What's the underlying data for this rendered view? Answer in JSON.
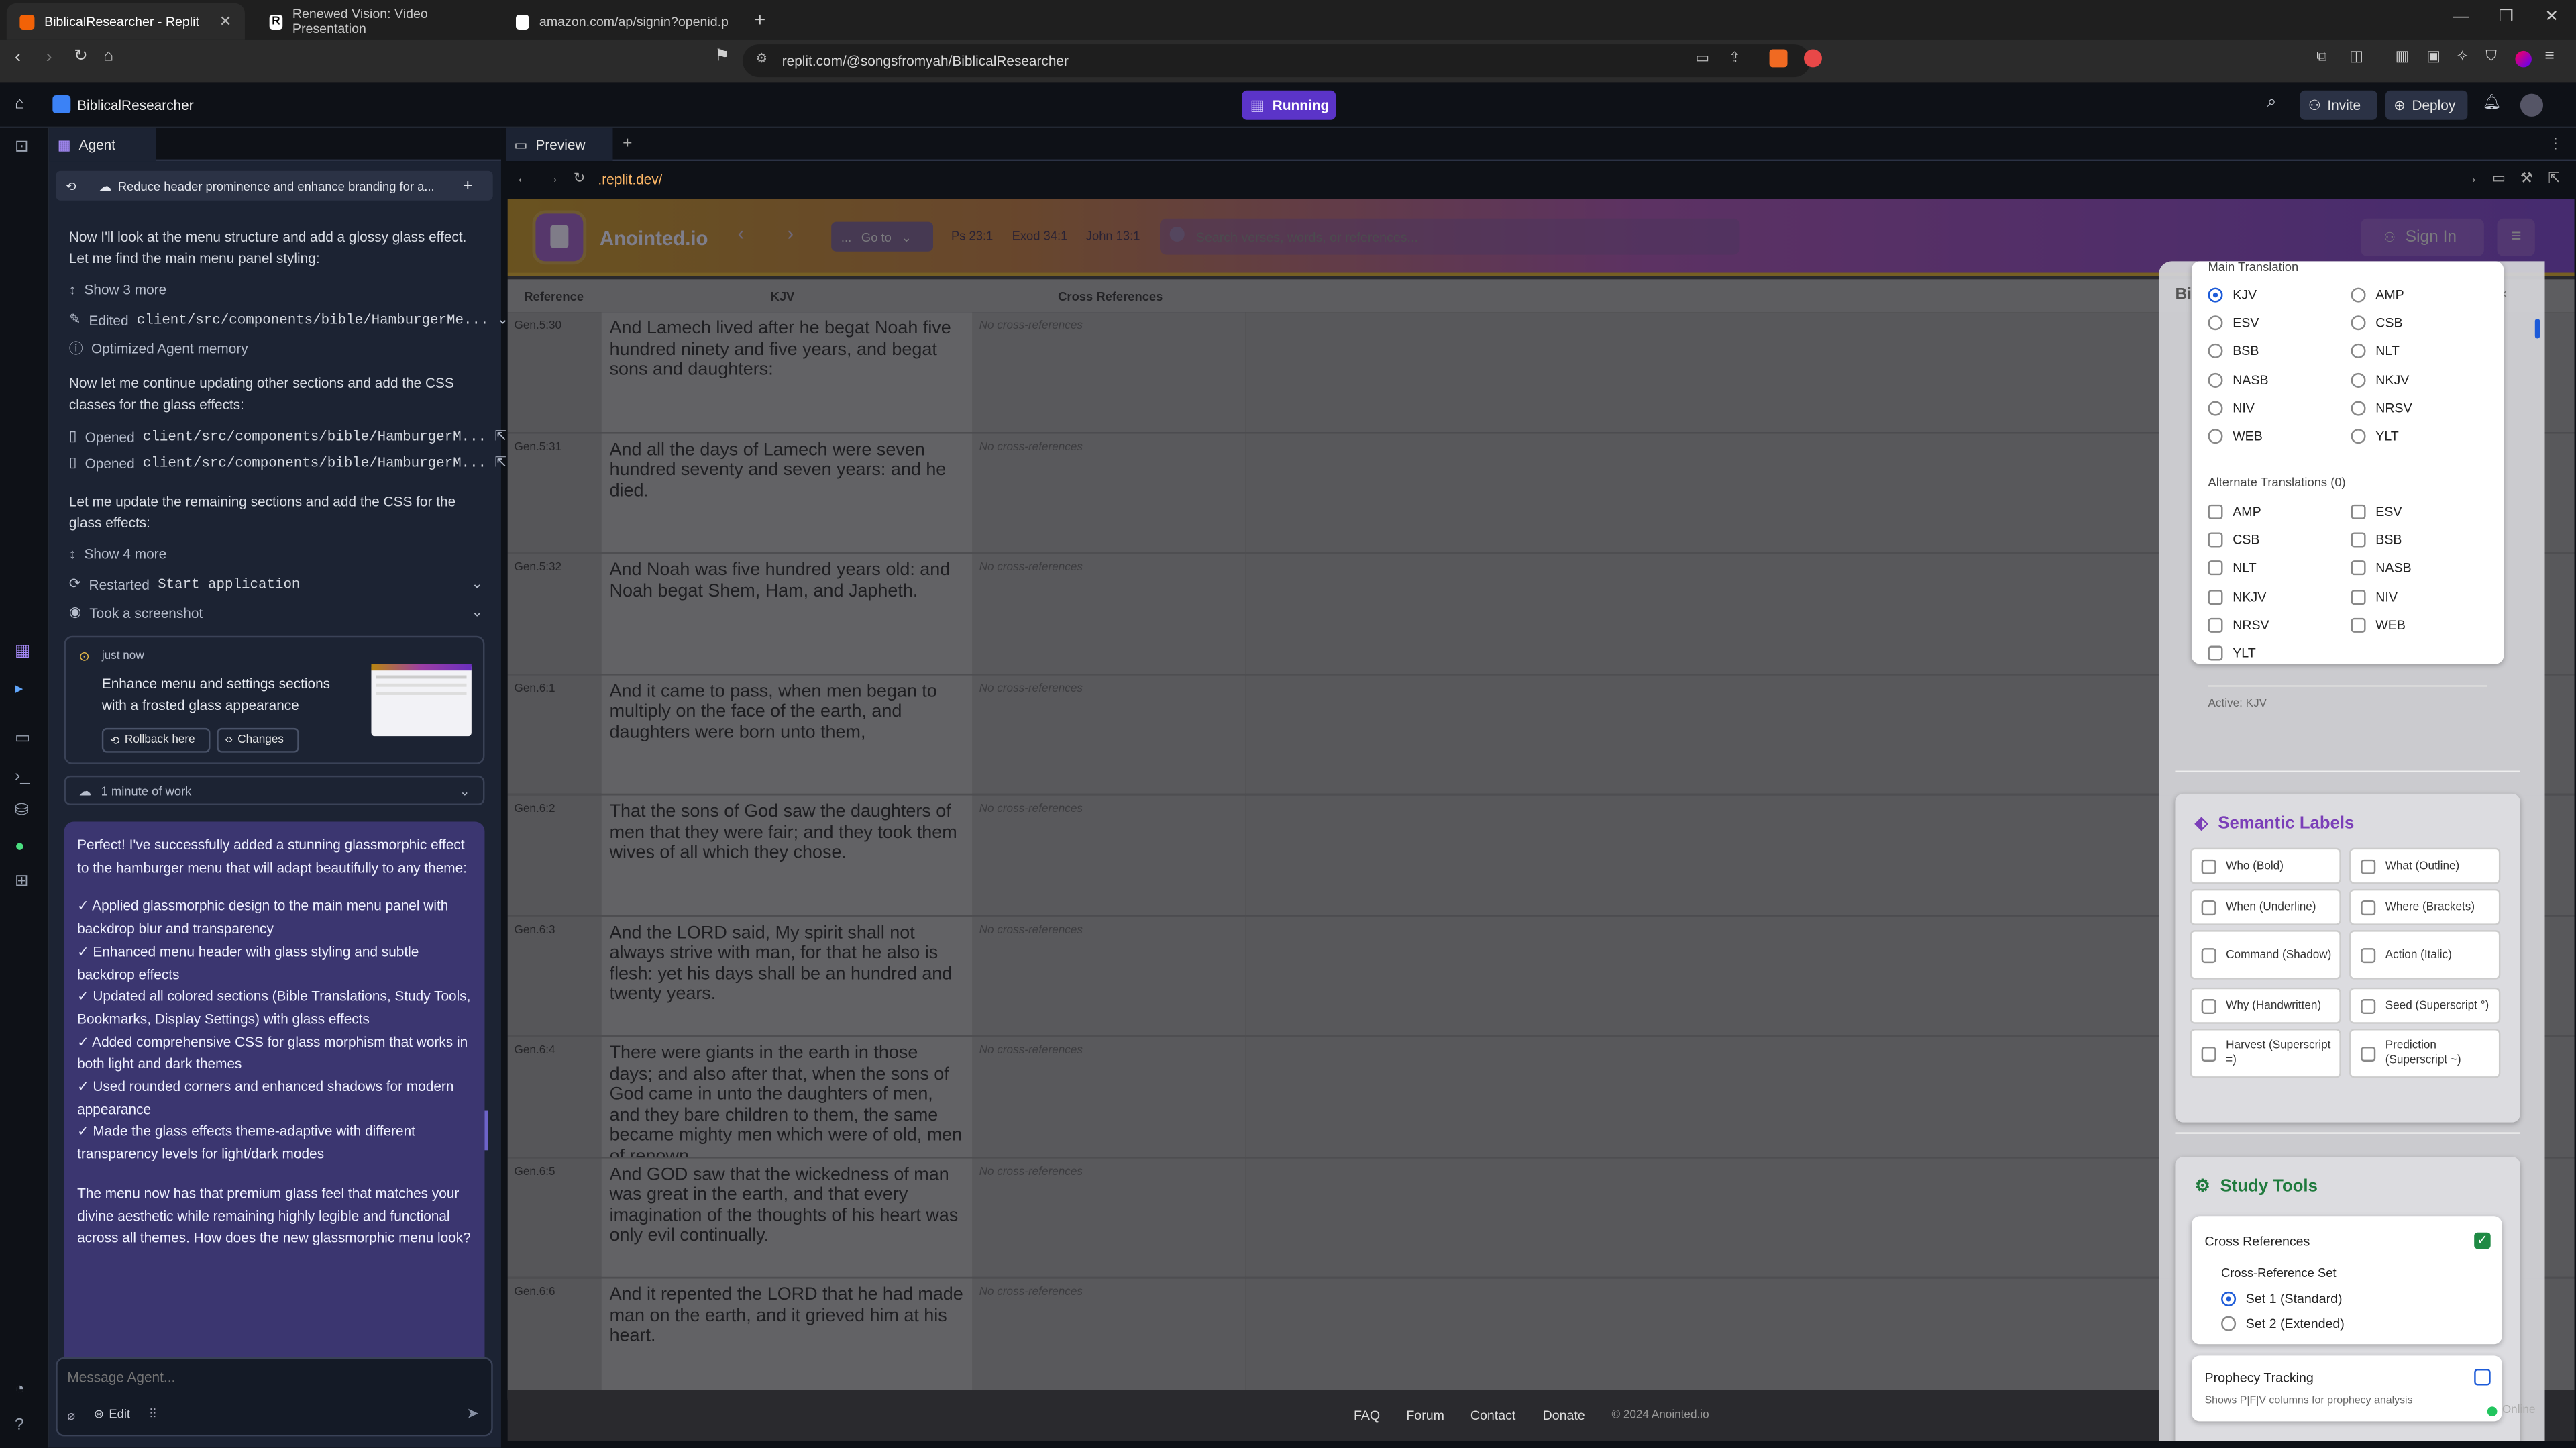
{
  "browser": {
    "tabs": [
      {
        "title": "BiblicalResearcher - Replit",
        "active": true
      },
      {
        "title": "Renewed Vision: Video Presentation",
        "active": false
      },
      {
        "title": "amazon.com/ap/signin?openid.pape",
        "active": false
      }
    ],
    "url": "replit.com/@songsfromyah/BiblicalResearcher"
  },
  "replit": {
    "repl_name": "BiblicalResearcher",
    "run_status": "Running",
    "invite_label": "Invite",
    "deploy_label": "Deploy"
  },
  "agent": {
    "tab_label": "Agent",
    "thread_title": "Reduce header prominence and enhance branding for a...",
    "msg1": "Now I'll look at the menu structure and add a glossy glass effect. Let me find the main menu panel styling:",
    "show3": "Show 3 more",
    "edited_label": "Edited",
    "edited_file": "client/src/components/bible/HamburgerMe...",
    "optimized": "Optimized Agent memory",
    "msg2": "Now let me continue updating other sections and add the CSS classes for the glass effects:",
    "opened_label": "Opened",
    "opened_file1": "client/src/components/bible/HamburgerM...",
    "opened_file2": "client/src/components/bible/HamburgerM...",
    "msg3": "Let me update the remaining sections and add the CSS for the glass effects:",
    "show4": "Show 4 more",
    "restarted_label": "Restarted",
    "restarted_target": "Start application",
    "screenshot": "Took a screenshot",
    "checkpoint_time": "just now",
    "checkpoint_text": "Enhance menu and settings sections with a frosted glass appearance",
    "rollback_label": "Rollback here",
    "changes_label": "Changes",
    "work_label": "1 minute of work",
    "final_intro": "Perfect! I've successfully added a stunning glassmorphic effect to the hamburger menu that will adapt beautifully to any theme:",
    "final_points": [
      "✓ Applied glassmorphic design to the main menu panel with backdrop blur and transparency",
      "✓ Enhanced menu header with glass styling and subtle backdrop effects",
      "✓ Updated all colored sections (Bible Translations, Study Tools, Bookmarks, Display Settings) with glass effects",
      "✓ Added comprehensive CSS for glass morphism that works in both light and dark themes",
      "✓ Used rounded corners and enhanced shadows for modern appearance",
      "✓ Made the glass effects theme-adaptive with different transparency levels for light/dark modes"
    ],
    "final_outro": "The menu now has that premium glass feel that matches your divine aesthetic while remaining highly legible and functional across all themes. How does the new glassmorphic menu look?",
    "input_placeholder": "Message Agent...",
    "edit_label": "Edit"
  },
  "preview": {
    "tab_label": "Preview",
    "address": ".replit.dev/",
    "site": {
      "brand": "Anointed.io",
      "goto_prefix": "...",
      "goto_label": "Go to",
      "quick_refs": [
        "Ps 23:1",
        "Exod 34:1",
        "John 13:1"
      ],
      "search_placeholder": "Search verses, words, or references...",
      "sign_in": "Sign In",
      "columns": [
        "Reference",
        "KJV",
        "Cross References"
      ],
      "verses": [
        {
          "ref": "Gen.5:30",
          "text": "And Lamech lived after he begat Noah five hundred ninety and five years, and begat sons and daughters:",
          "cross": "No cross-references"
        },
        {
          "ref": "Gen.5:31",
          "text": "And all the days of Lamech were seven hundred seventy and seven years: and he died.",
          "cross": "No cross-references"
        },
        {
          "ref": "Gen.5:32",
          "text": "And Noah was five hundred years old: and Noah begat Shem, Ham, and Japheth.",
          "cross": "No cross-references"
        },
        {
          "ref": "Gen.6:1",
          "text": "And it came to pass, when men began to multiply on the face of the earth, and daughters were born unto them,",
          "cross": "No cross-references"
        },
        {
          "ref": "Gen.6:2",
          "text": "That the sons of God saw the daughters of men that they were fair; and they took them wives of all which they chose.",
          "cross": "No cross-references"
        },
        {
          "ref": "Gen.6:3",
          "text": "And the LORD said, My spirit shall not always strive with man, for that he also is flesh: yet his days shall be an hundred and twenty years.",
          "cross": "No cross-references"
        },
        {
          "ref": "Gen.6:4",
          "text": "There were giants in the earth in those days; and also after that, when the sons of God came in unto the daughters of men, and they bare children to them, the same became mighty men which were of old, men of renown.",
          "cross": "No cross-references"
        },
        {
          "ref": "Gen.6:5",
          "text": "And GOD saw that the wickedness of man was great in the earth, and that every imagination of the thoughts of his heart was only evil continually.",
          "cross": "No cross-references"
        },
        {
          "ref": "Gen.6:6",
          "text": "And it repented the LORD that he had made man on the earth, and it grieved him at his heart.",
          "cross": "No cross-references"
        }
      ],
      "footer_links": [
        "FAQ",
        "Forum",
        "Contact",
        "Donate"
      ],
      "copyright": "© 2024 Anointed.io",
      "online": "Online"
    },
    "menu": {
      "main_translation_label": "Main Translation",
      "main_translations": [
        {
          "name": "KJV",
          "selected": true
        },
        {
          "name": "AMP",
          "selected": false
        },
        {
          "name": "ESV",
          "selected": false
        },
        {
          "name": "CSB",
          "selected": false
        },
        {
          "name": "BSB",
          "selected": false
        },
        {
          "name": "NLT",
          "selected": false
        },
        {
          "name": "NASB",
          "selected": false
        },
        {
          "name": "NKJV",
          "selected": false
        },
        {
          "name": "NIV",
          "selected": false
        },
        {
          "name": "NRSV",
          "selected": false
        },
        {
          "name": "WEB",
          "selected": false
        },
        {
          "name": "YLT",
          "selected": false
        }
      ],
      "alternate_label": "Alternate Translations (0)",
      "alternates": [
        "AMP",
        "ESV",
        "CSB",
        "BSB",
        "NLT",
        "NASB",
        "NKJV",
        "NIV",
        "NRSV",
        "WEB",
        "YLT"
      ],
      "active_label": "Active: KJV",
      "semantic_title": "Semantic Labels",
      "semantic_labels": [
        "Who (Bold)",
        "What (Outline)",
        "When (Underline)",
        "Where (Brackets)",
        "Command (Shadow)",
        "Action (Italic)",
        "Why (Handwritten)",
        "Seed (Superscript °)",
        "Harvest (Superscript =)",
        "Prediction (Superscript ~)"
      ],
      "study_title": "Study Tools",
      "cross_ref_label": "Cross References",
      "cross_ref_set_label": "Cross-Reference Set",
      "set1": "Set 1 (Standard)",
      "set2": "Set 2 (Extended)",
      "prophecy_label": "Prophecy Tracking",
      "prophecy_desc": "Shows P|F|V columns for prophecy analysis",
      "partial_heading": "Bi"
    }
  },
  "colors": {
    "accent_purple": "#7c3aed",
    "semantic_purple": "#7b3fb8",
    "study_green": "#1f7a3d",
    "link_orange": "#ffb866"
  }
}
